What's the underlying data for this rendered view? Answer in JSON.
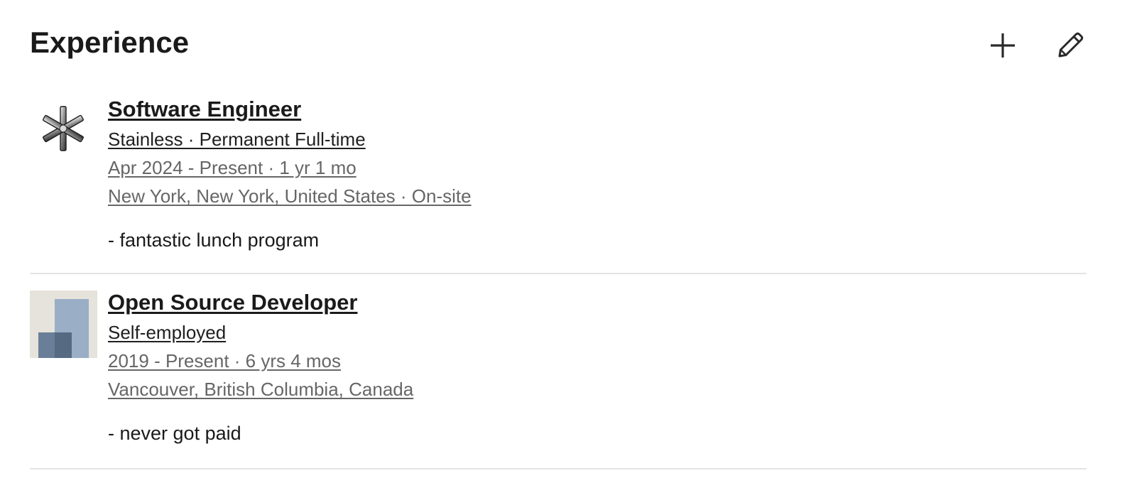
{
  "section": {
    "title": "Experience",
    "actions": {
      "add_icon": "plus-icon",
      "edit_icon": "pencil-icon"
    }
  },
  "experiences": [
    {
      "title": "Software Engineer",
      "company": "Stainless · Permanent Full-time",
      "dates": "Apr 2024 - Present · 1 yr 1 mo",
      "location": "New York, New York, United States · On-site",
      "description": "- fantastic lunch program",
      "logo": "stainless-asterisk-logo"
    },
    {
      "title": "Open Source Developer",
      "company": "Self-employed",
      "dates": "2019 - Present · 6 yrs 4 mos",
      "location": "Vancouver, British Columbia, Canada",
      "description": "- never got paid",
      "logo": "self-employed-blocks-logo"
    }
  ],
  "colors": {
    "title": "#1a1a1a",
    "meta": "#666666",
    "divider": "#e4e4e4",
    "logo_bg": "#e6e2dc",
    "logo_block_light": "#9aaec6",
    "logo_block_dark": "#566a82"
  }
}
